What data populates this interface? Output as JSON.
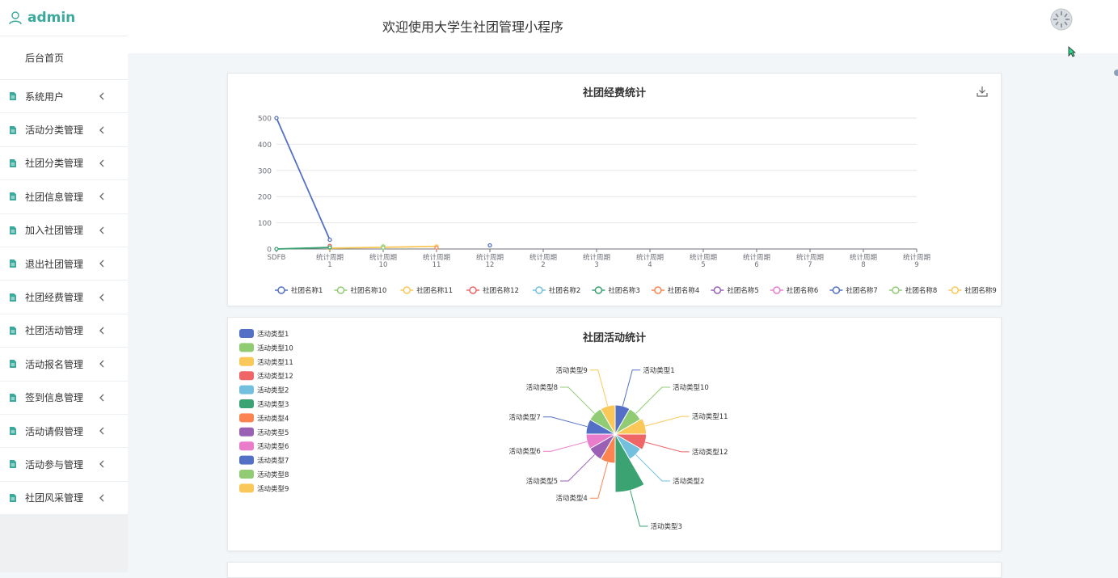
{
  "sidebar": {
    "brand": "admin",
    "home": "后台首页",
    "items": [
      {
        "label": "系统用户"
      },
      {
        "label": "活动分类管理"
      },
      {
        "label": "社团分类管理"
      },
      {
        "label": "社团信息管理"
      },
      {
        "label": "加入社团管理"
      },
      {
        "label": "退出社团管理"
      },
      {
        "label": "社团经费管理"
      },
      {
        "label": "社团活动管理"
      },
      {
        "label": "活动报名管理"
      },
      {
        "label": "签到信息管理"
      },
      {
        "label": "活动请假管理"
      },
      {
        "label": "活动参与管理"
      },
      {
        "label": "社团风采管理"
      }
    ]
  },
  "header": {
    "title": "欢迎使用大学生社团管理小程序"
  },
  "icons": {
    "user": "user-icon",
    "doc": "doc-icon",
    "chevron": "chevron-left-icon",
    "download": "download-icon",
    "avatar": "avatar-icon",
    "cursor": "cursor-icon"
  },
  "colors": {
    "brand": "#3ba99b",
    "palette": [
      "#5470c6",
      "#91cc75",
      "#fac858",
      "#ee6666",
      "#73c0de",
      "#3ba272",
      "#fc8452",
      "#9a60b4",
      "#ea7ccc",
      "#5470c6",
      "#91cc75",
      "#fac858"
    ]
  },
  "chart_data": [
    {
      "type": "line",
      "title": "社团经费统计",
      "categories": [
        "SDFB",
        "统计周期 1",
        "统计周期 10",
        "统计周期 11",
        "统计周期 12",
        "统计周期 2",
        "统计周期 3",
        "统计周期 4",
        "统计周期 5",
        "统计周期 6",
        "统计周期 7",
        "统计周期 8",
        "统计周期 9"
      ],
      "ylim": [
        0,
        500
      ],
      "yticks": [
        0,
        100,
        200,
        300,
        400,
        500
      ],
      "grid": true,
      "legend_position": "bottom",
      "series": [
        {
          "name": "社团名称1",
          "points": [
            [
              0,
              500
            ],
            [
              1,
              35
            ]
          ]
        },
        {
          "name": "社团名称10",
          "points": [
            [
              2,
              10
            ]
          ]
        },
        {
          "name": "社团名称11",
          "points": [
            [
              1,
              3
            ],
            [
              3,
              10
            ]
          ]
        },
        {
          "name": "社团名称12",
          "points": [
            [
              1,
              12
            ]
          ]
        },
        {
          "name": "社团名称2",
          "points": []
        },
        {
          "name": "社团名称3",
          "points": [
            [
              0,
              0
            ],
            [
              1,
              6
            ]
          ]
        },
        {
          "name": "社团名称4",
          "points": [
            [
              3,
              5
            ]
          ]
        },
        {
          "name": "社团名称5",
          "points": []
        },
        {
          "name": "社团名称6",
          "points": []
        },
        {
          "name": "社团名称7",
          "points": [
            [
              4,
              14
            ]
          ]
        },
        {
          "name": "社团名称8",
          "points": [
            [
              2,
              5
            ]
          ]
        },
        {
          "name": "社团名称9",
          "points": []
        }
      ]
    },
    {
      "type": "pie",
      "title": "社团活动统计",
      "rose": true,
      "legend_position": "top-left",
      "slices": [
        {
          "label": "活动类型1",
          "value": 5
        },
        {
          "label": "活动类型10",
          "value": 5
        },
        {
          "label": "活动类型11",
          "value": 5.5
        },
        {
          "label": "活动类型12",
          "value": 5.5
        },
        {
          "label": "活动类型2",
          "value": 5
        },
        {
          "label": "活动类型3",
          "value": 12
        },
        {
          "label": "活动类型4",
          "value": 5
        },
        {
          "label": "活动类型5",
          "value": 5
        },
        {
          "label": "活动类型6",
          "value": 5
        },
        {
          "label": "活动类型7",
          "value": 5
        },
        {
          "label": "活动类型8",
          "value": 5
        },
        {
          "label": "活动类型9",
          "value": 5
        }
      ]
    }
  ]
}
